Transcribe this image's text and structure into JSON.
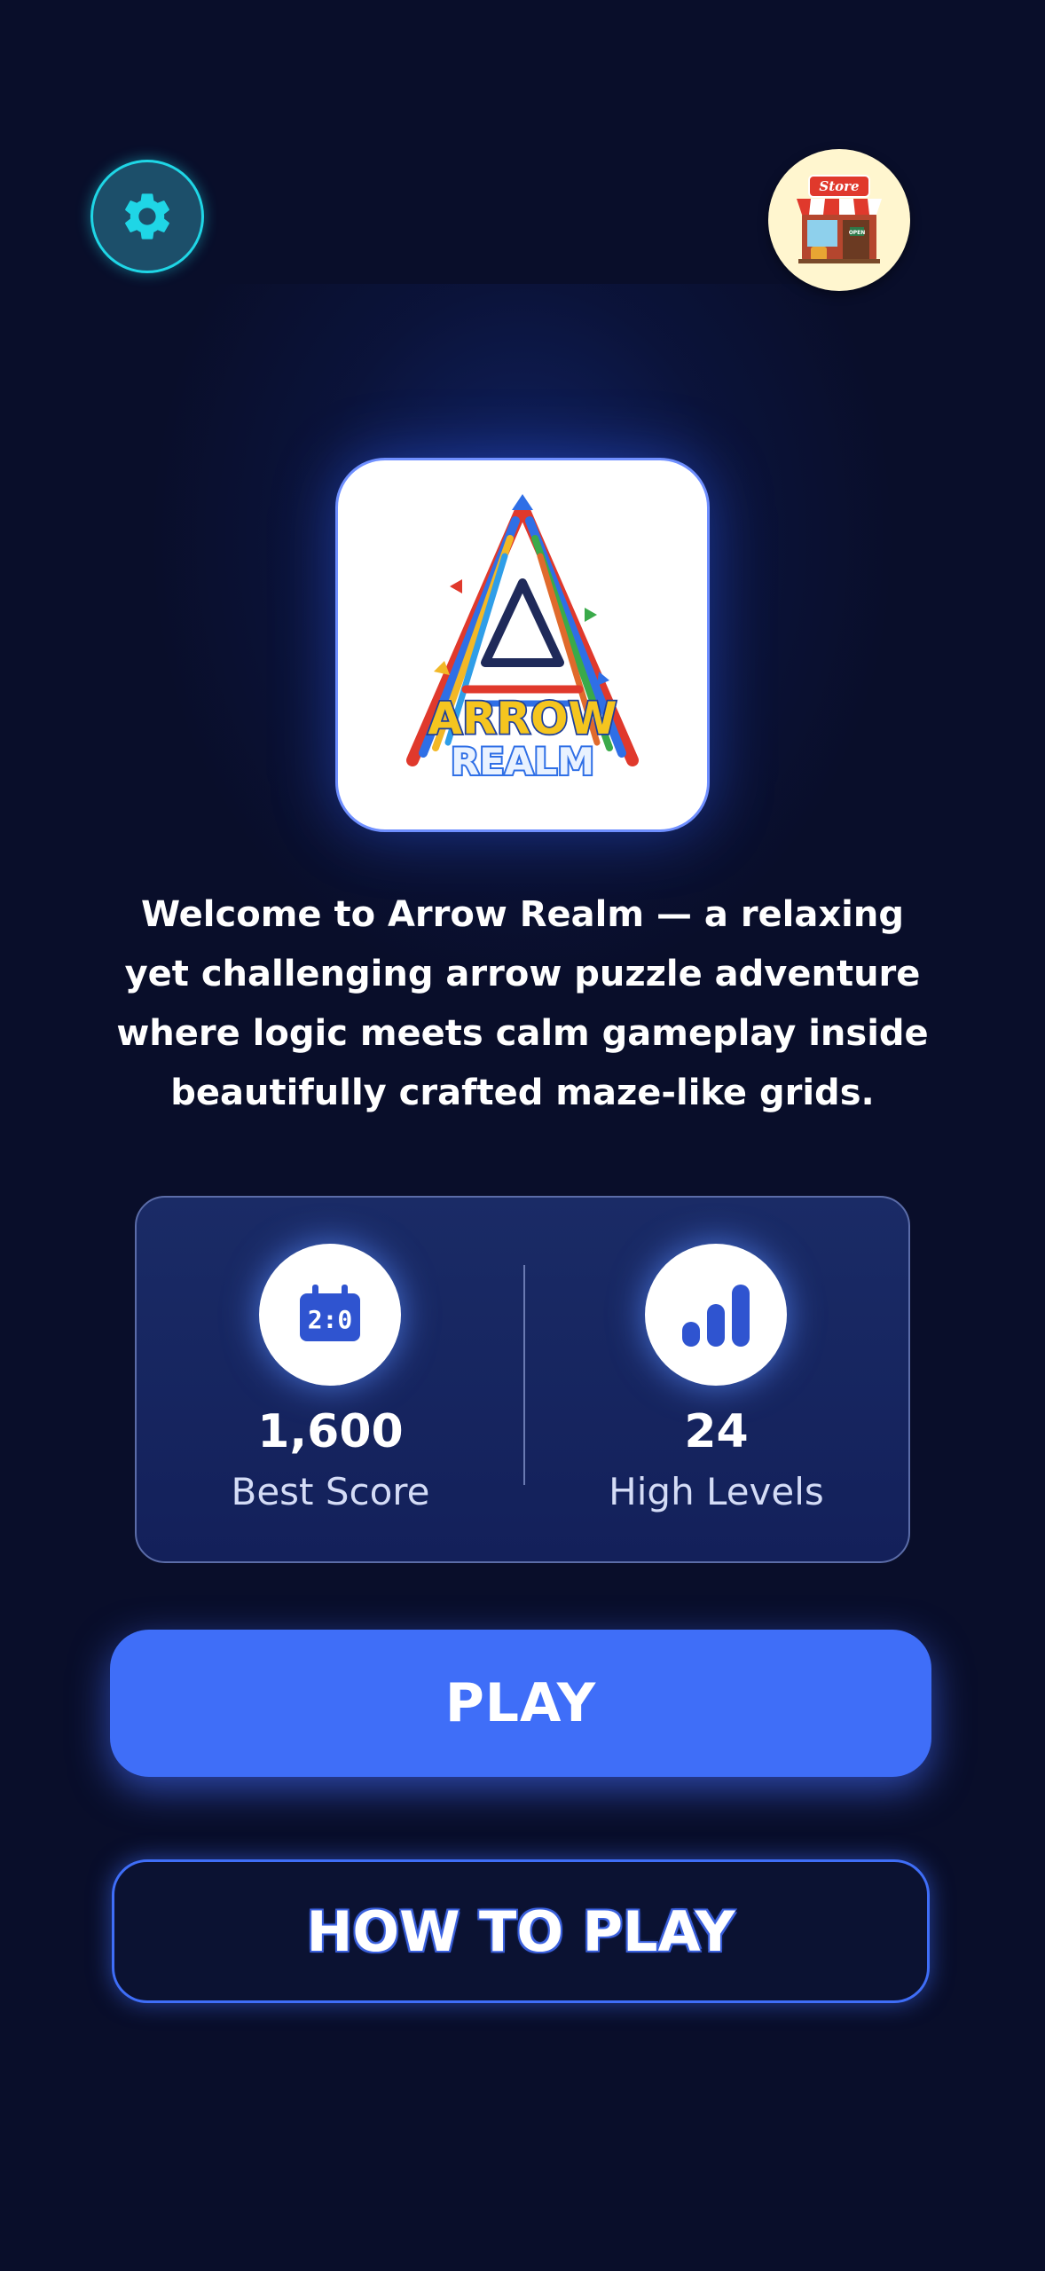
{
  "header": {
    "settings_icon": "gear-icon",
    "store_icon": "store-icon",
    "store_sign_text": "Store",
    "store_open_sign": "OPEN"
  },
  "logo": {
    "line1": "ARROW",
    "line2": "REALM"
  },
  "welcome_text": "Welcome to Arrow Realm — a relaxing yet challenging arrow puzzle adventure where logic meets calm gameplay inside beautifully crafted maze-like grids.",
  "stats": {
    "best_score": {
      "icon": "scoreboard-icon",
      "icon_text": "2:0",
      "value": "1,600",
      "label": "Best Score"
    },
    "high_levels": {
      "icon": "bar-chart-icon",
      "value": "24",
      "label": "High Levels"
    }
  },
  "buttons": {
    "play_label": "PLAY",
    "how_to_play_label": "HOW TO PLAY"
  },
  "colors": {
    "background": "#090e2a",
    "accent_blue": "#3f6ef8",
    "settings_cyan": "#1fd6e6",
    "store_bg": "#fff6cf",
    "stats_card": "#16245e"
  }
}
